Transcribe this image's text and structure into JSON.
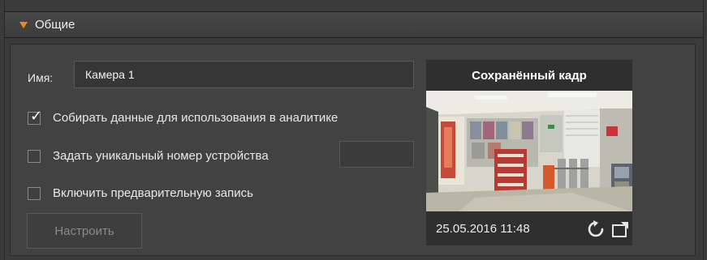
{
  "section": {
    "title": "Общие"
  },
  "name_field": {
    "label": "Имя:",
    "value": "Камера 1"
  },
  "options": [
    {
      "label": "Собирать данные для использования в аналитике",
      "checked": true
    },
    {
      "label": "Задать уникальный номер устройства",
      "checked": false
    },
    {
      "label": "Включить предварительную запись",
      "checked": false
    }
  ],
  "unique_number": {
    "value": ""
  },
  "configure_button": {
    "label": "Настроить",
    "enabled": false
  },
  "saved_frame": {
    "title": "Сохранённый кадр",
    "timestamp": "25.05.2016 11:48",
    "refresh_icon": "refresh-icon",
    "expand_icon": "window-expand-icon"
  },
  "colors": {
    "accent": "#f08a1a",
    "panel": "#424242",
    "background": "#3a3a3a"
  }
}
